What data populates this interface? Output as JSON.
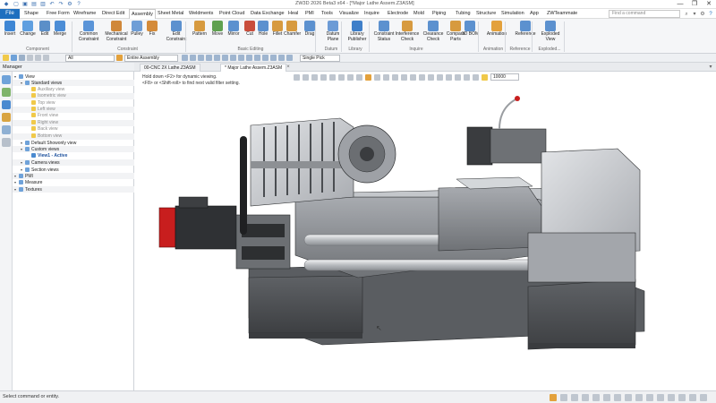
{
  "window": {
    "title": "ZW3D 2026 Beta3 x64 - [*Major Lathe Assem.Z3ASM]",
    "controls": [
      "—",
      "❐",
      "✕"
    ]
  },
  "menu": {
    "file": "File",
    "items": [
      "Shape",
      "Free Form",
      "Wireframe",
      "Direct Edit",
      "Assembly",
      "Sheet Metal",
      "Weldments",
      "Point Cloud",
      "Data Exchange",
      "Heal",
      "PMI",
      "Tools",
      "Visualize",
      "Inquire",
      "Electrode",
      "Mold",
      "Piping",
      "Tubing",
      "Structure",
      "Simulation",
      "App",
      "ZWTeammate"
    ],
    "active_index": 4,
    "find_placeholder": "Find a command"
  },
  "ribbon": {
    "buttons": [
      "Insert",
      "Change",
      "Edit",
      "Merge",
      "Common\nConstraint",
      "Mechanical\nConstraint",
      "Pulley",
      "Fix",
      "Edit\nConstraint",
      "Pattern",
      "Move",
      "Mirror",
      "Cut",
      "Hole",
      "Fillet",
      "Chamfer",
      "Drag",
      "Datum\nPlane",
      "Library\nPublisher",
      "Constraint\nStatus",
      "Interference\nCheck",
      "Clearance\nCheck",
      "Compare\nParts",
      "3D BOM",
      "Animation",
      "Reference",
      "Exploded\nView"
    ],
    "groups": [
      "Component",
      "Constraint",
      "Basic Editing",
      "Datum",
      "Library",
      "Inquire",
      "Animation",
      "Reference",
      "Exploded..."
    ]
  },
  "toolbar": {
    "filter_all": "All",
    "filter_assembly": "Entire Assembly",
    "pick": "Single Pick",
    "zoom": "10000"
  },
  "tabs": [
    {
      "label": "00-CNC 2X Lathe.Z3ASM",
      "active": false
    },
    {
      "label": "* Major Lathe Assem.Z3ASM",
      "active": true
    }
  ],
  "manager": {
    "title": "Manager",
    "tree": [
      {
        "label": "View",
        "indent": 0,
        "state": "normal"
      },
      {
        "label": "Standard views",
        "indent": 1,
        "state": "normal"
      },
      {
        "label": "Auxiliary view",
        "indent": 2,
        "state": "greyed"
      },
      {
        "label": "Isometric view",
        "indent": 2,
        "state": "greyed"
      },
      {
        "label": "Top view",
        "indent": 2,
        "state": "greyed"
      },
      {
        "label": "Left view",
        "indent": 2,
        "state": "greyed"
      },
      {
        "label": "Front view",
        "indent": 2,
        "state": "greyed"
      },
      {
        "label": "Right view",
        "indent": 2,
        "state": "greyed"
      },
      {
        "label": "Back view",
        "indent": 2,
        "state": "greyed"
      },
      {
        "label": "Bottom view",
        "indent": 2,
        "state": "greyed"
      },
      {
        "label": "Default Showonly view",
        "indent": 1,
        "state": "normal"
      },
      {
        "label": "Custom views",
        "indent": 1,
        "state": "normal"
      },
      {
        "label": "View1 - Active",
        "indent": 2,
        "state": "active"
      },
      {
        "label": "Camera views",
        "indent": 1,
        "state": "normal"
      },
      {
        "label": "Section views",
        "indent": 1,
        "state": "normal"
      },
      {
        "label": "PMI",
        "indent": 0,
        "state": "normal"
      },
      {
        "label": "Measure",
        "indent": 0,
        "state": "normal"
      },
      {
        "label": "Textures",
        "indent": 0,
        "state": "normal"
      }
    ]
  },
  "viewport": {
    "hint_line1": "Hold down <F2> for dynamic viewing.",
    "hint_line2": "<F8> or <Shift-roll> to find next valid filter setting."
  },
  "status": {
    "text": "Select command or entity."
  },
  "colors": {
    "accent": "#1e6fbf",
    "motor_red": "#c81e1e",
    "machine_grey": "#8a8d91"
  }
}
